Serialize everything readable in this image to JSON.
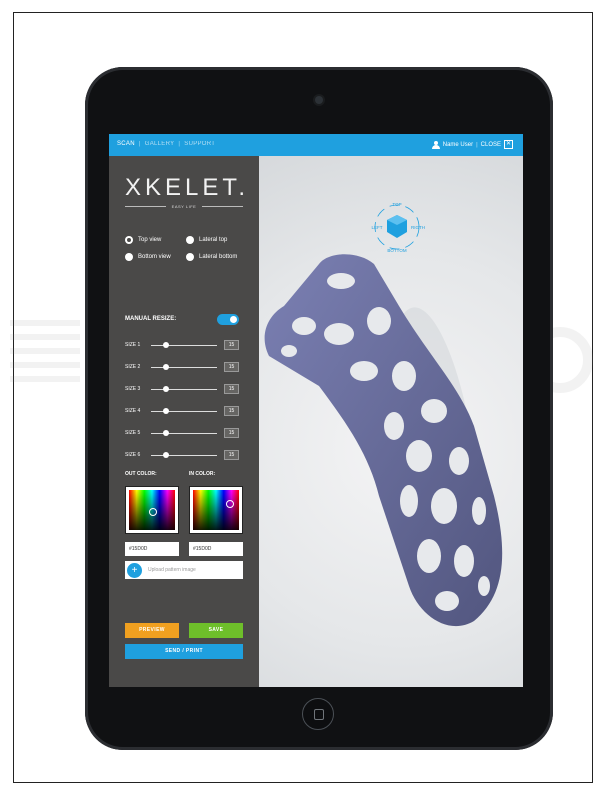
{
  "app": {
    "tabs": [
      {
        "label": "SCAN"
      },
      {
        "label": "GALLERY"
      },
      {
        "label": "SUPPORT"
      }
    ],
    "separator": "|",
    "user_name": "Name User",
    "close_label": "CLOSE",
    "close_glyph": "✕"
  },
  "sidebar": {
    "logo": "XKELET.",
    "subtitle": "EASY LIFE",
    "view_options": [
      {
        "label": "Top view",
        "selected": true
      },
      {
        "label": "Lateral top",
        "selected": false
      },
      {
        "label": "Bottom view",
        "selected": false
      },
      {
        "label": "Lateral bottom",
        "selected": false
      }
    ],
    "manual_resize_label": "MANUAL RESIZE:",
    "manual_resize_on": true,
    "sizes": [
      {
        "label": "SIZE 1",
        "value": "15",
        "level": 0.2
      },
      {
        "label": "SIZE 2",
        "value": "15",
        "level": 0.2
      },
      {
        "label": "SIZE 3",
        "value": "15",
        "level": 0.2
      },
      {
        "label": "SIZE 4",
        "value": "15",
        "level": 0.2
      },
      {
        "label": "SIZE 5",
        "value": "15",
        "level": 0.2
      },
      {
        "label": "SIZE 6",
        "value": "15",
        "level": 0.2
      }
    ],
    "out_color_label": "OUT COLOR:",
    "in_color_label": "IN COLOR:",
    "out_color_value": "#15D0D",
    "in_color_value": "#15D0D",
    "upload_label": "Upload pattern image",
    "upload_glyph": "+",
    "preview_label": "PREVIEW",
    "save_label": "SAVE",
    "send_label": "SEND / PRINT"
  },
  "viewport": {
    "cube_labels": {
      "top": "TOP",
      "left": "LEFT",
      "right": "RIGTH",
      "bottom": "BOTTOM"
    }
  },
  "colors": {
    "accent": "#1fa0df",
    "sidebar_bg": "#4a4948",
    "preview": "#f0a020",
    "save": "#6ebf2a",
    "send": "#1fa0df",
    "cast": "#6a6f9f"
  }
}
